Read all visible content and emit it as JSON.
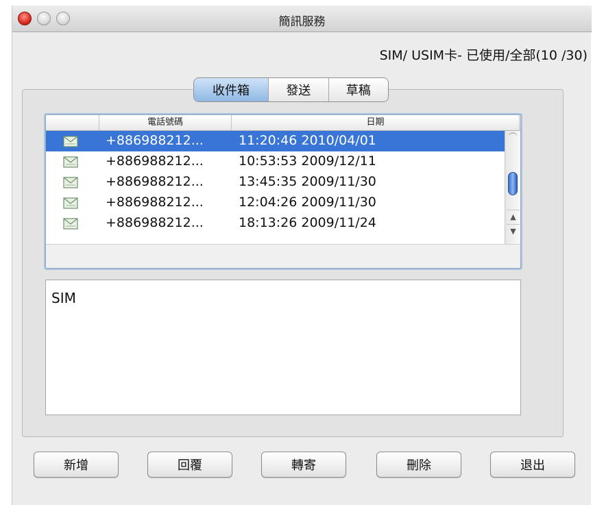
{
  "window": {
    "title": "簡訊服務"
  },
  "status": {
    "sim_usage": "SIM/ USIM卡- 已使用/全部(10 /30)"
  },
  "tabs": [
    {
      "label": "收件箱",
      "active": true
    },
    {
      "label": "發送",
      "active": false
    },
    {
      "label": "草稿",
      "active": false
    }
  ],
  "list": {
    "columns": [
      "",
      "電話號碼",
      "日期"
    ],
    "rows": [
      {
        "icon": "envelope-icon",
        "phone": "+886988212...",
        "date": "11:20:46 2010/04/01",
        "selected": true
      },
      {
        "icon": "envelope-icon",
        "phone": "+886988212...",
        "date": "10:53:53 2009/12/11",
        "selected": false
      },
      {
        "icon": "envelope-icon",
        "phone": "+886988212...",
        "date": "13:45:35 2009/11/30",
        "selected": false
      },
      {
        "icon": "envelope-icon",
        "phone": "+886988212...",
        "date": "12:04:26 2009/11/30",
        "selected": false
      },
      {
        "icon": "envelope-icon",
        "phone": "+886988212...",
        "date": "18:13:26 2009/11/24",
        "selected": false
      }
    ]
  },
  "preview": {
    "text": "SIM"
  },
  "buttons": {
    "new": "新增",
    "reply": "回覆",
    "forward": "轉寄",
    "delete": "刪除",
    "exit": "退出"
  },
  "colors": {
    "selection": "#3875d7",
    "tab_active": "#9ec2ea",
    "close_button": "#d4261a"
  }
}
